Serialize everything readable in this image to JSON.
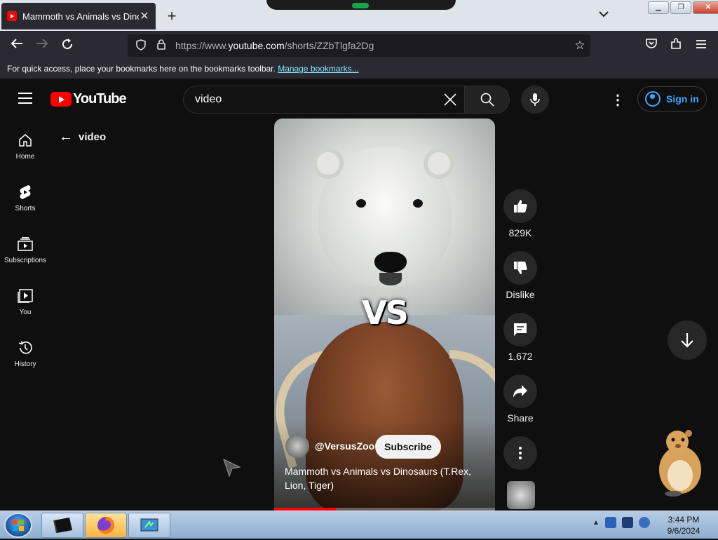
{
  "browser": {
    "tab_title": "Mammoth vs Animals vs Dinosaurs",
    "tab_close": "✕",
    "new_tab": "+",
    "tab_list": "⌄",
    "url_prefix": "https://www.",
    "url_domain": "youtube.com",
    "url_path": "/shorts/ZZbTlgfa2Dg",
    "bookmarks_text": "For quick access, place your bookmarks here on the bookmarks toolbar.",
    "bookmarks_link": "Manage bookmarks..."
  },
  "youtube": {
    "logo_text": "YouTube",
    "search_value": "video",
    "sign_in": "Sign in",
    "back_label": "video",
    "sidebar": [
      {
        "label": "Home"
      },
      {
        "label": "Shorts"
      },
      {
        "label": "Subscriptions"
      },
      {
        "label": "You"
      },
      {
        "label": "History"
      }
    ],
    "video": {
      "overlay_text": "VS",
      "channel": "@VersusZoo",
      "subscribe": "Subscribe",
      "title": "Mammoth vs Animals vs Dinosaurs (T.Rex, Lion, Tiger)",
      "progress": 0.28
    },
    "actions": {
      "likes": "829K",
      "dislike": "Dislike",
      "comments": "1,672",
      "share": "Share"
    }
  },
  "taskbar": {
    "time": "3:44 PM",
    "date": "9/6/2024"
  }
}
